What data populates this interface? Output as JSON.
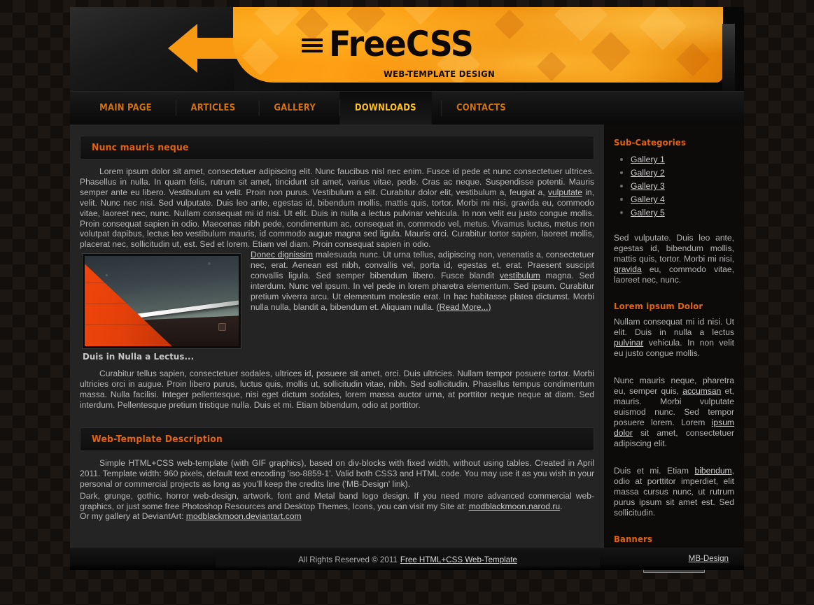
{
  "header": {
    "logo_title": "FreeCSS",
    "logo_subtitle": "WEB-TEMPLATE DESIGN",
    "arrow_icon": "back-arrow-icon",
    "equals_icon": "equals-mark-icon",
    "brand_color": "#f79a11"
  },
  "nav": {
    "items": [
      {
        "label": "MAIN PAGE",
        "active": false
      },
      {
        "label": "ARTICLES",
        "active": false
      },
      {
        "label": "GALLERY",
        "active": false
      },
      {
        "label": "DOWNLOADS",
        "active": true
      },
      {
        "label": "CONTACTS",
        "active": false
      }
    ],
    "link_color": "#d1720f",
    "active_color": "#ffc21a"
  },
  "content": {
    "section1_title": "Nunc mauris neque",
    "para1_a": "Lorem ipsum dolor sit amet, consectetuer adipiscing elit. Nunc faucibus nisl nec enim. Fusce id pede et nunc consectetuer ultrices. Phasellus in nulla. In quam felis, rutrum sit amet, tincidunt sit amet, varius vitae, pede. Cras ac neque. Suspendisse potenti. Mauris semper ante eu libero. Vestibulum eu velit. Proin non purus. Vestibulum a elit. Curabitur dolor elit, vestibulum a, feugiat a, ",
    "para1_link1": "vulputate",
    "para1_b": " in, velit. Nunc nec nisi. Sed vulputate. Duis leo ante, egestas id, bibendum mollis, mattis quis, tortor. Morbi mi nisi, gravida eu, commodo vitae, laoreet nec, nunc. Nullam consequat mi id nisi. Ut elit. Duis in nulla a lectus pulvinar vehicula. In non velit eu justo congue mollis. Proin consequat sapien in odio. Maecenas nibh pede, condimentum ac, consequat in, commodo vel, metus. Vivamus luctus, metus non volutpat dapibus, lectus leo vestibulum mauris, id commodo augue magna sed ligula. Mauris orci. Curabitur tortor sapien, laoreet mollis, placerat nec, sollicitudin ut, est. Sed et lorem. Etiam vel diam. Proin consequat sapien in odio. ",
    "para1_link2": "Donec dignissim",
    "para1_c": " malesuada nunc. Ut urna tellus, adipiscing non, venenatis a, consectetuer nec, erat. Aenean est nibh, convallis vel, porta id, egestas et, erat. Praesent suscipit convallis ligula. Sed semper bibendum libero. Fusce blandit ",
    "para1_link3": "vestibulum",
    "para1_d": " magna. Sed interdum. Nunc vel ipsum. In vel pede in lorem pharetra elementum. Sed ipsum. Curabitur pretium viverra arcu. Ut elementum molestie erat. In hac habitasse platea dictumst. Morbi nulla nulla, blandit a, bibendum et. Aliquam nulla. ",
    "read_more": "(Read More...)",
    "subhead1": "Duis in Nulla a Lectus...",
    "para2": "Curabitur tellus sapien, consectetuer sodales, ultrices id, posuere sit amet, orci. Duis ultricies. Nullam tempor posuere tortor. Morbi ultricies orci in augue. Proin libero purus, luctus quis, mollis ut, sollicitudin vitae, nibh. Sed sollicitudin. Phasellus tempus condimentum massa. Nulla facilisi. Integer pellentesque, nisi eget dictum sodales, lorem massa auctor urna, at porttitor neque neque at diam. Sed interdum. Pellentesque pretium tristique nulla. Duis et mi. Etiam bibendum, odio at porttitor.",
    "section2_title": "Web-Template Description",
    "desc_p1": "Simple HTML+CSS web-template (with GIF graphics), based on div-blocks with fixed width, without using tables. Created in April 2011. Template width: 960 pixels, default text encoding 'iso-8859-1'. Valid both CSS3 and HTML code. You may use it as you wish in your personal or commercial projects as long as you'll keep the credits line ('MB-Design' link).",
    "desc_p2_a": "Dark, grunge, gothic, horror web-design, artwork, font and Metal band logo design. If you need more advanced commercial web-graphics, or just some free Photoshop Resources and Desktop Themes, Icons, you can visit my Site at: ",
    "desc_link1": "modblackmoon.narod.ru",
    "desc_p2_b": ".",
    "desc_p3_a": "Or my gallery at DeviantArt: ",
    "desc_link2": "modblackmoon.deviantart.com",
    "figure_alt": "article-photo"
  },
  "sidebar": {
    "subcat_title": "Sub-Categories",
    "gallery_links": [
      "Gallery 1",
      "Gallery 2",
      "Gallery 3",
      "Gallery 4",
      "Gallery 5"
    ],
    "para1_a": "Sed vulputate. Duis leo ante, egestas id, bibendum mollis, mattis quis, tortor. Morbi mi nisi, ",
    "para1_link": "gravida",
    "para1_b": " eu, commodo vitae, laoreet nec, nunc.",
    "lorem_title": "Lorem ipsum Dolor",
    "para2_a": "Nullam consequat mi id nisi. Ut elit. Duis in nulla a lectus ",
    "para2_link": "pulvinar",
    "para2_b": " vehicula. In non velit eu justo congue mollis.",
    "para3_a": "Nunc mauris neque, pharetra eu, semper quis, ",
    "para3_link1": "accumsan",
    "para3_b": " et, mauris.   Morbi   vulputate euismod nunc. Sed tempor posuere lorem. Lorem ",
    "para3_link2": "ipsum dolor",
    "para3_c": " sit amet, consectetuer adipiscing elit.",
    "para4_a": "Duis et mi. Etiam ",
    "para4_link": "bibendum",
    "para4_b": ", odio at porttitor imperdiet, elit massa cursus nunc, ut rutrum purus ipsum sit amet est. Sed sollicitudin.",
    "banners_title": "Banners",
    "banner_alt": "banner-placeholder"
  },
  "footer": {
    "copy_text": "All Rights Reserved © 2011",
    "copy_link": "Free HTML+CSS Web-Template",
    "right_link": "MB-Design"
  }
}
